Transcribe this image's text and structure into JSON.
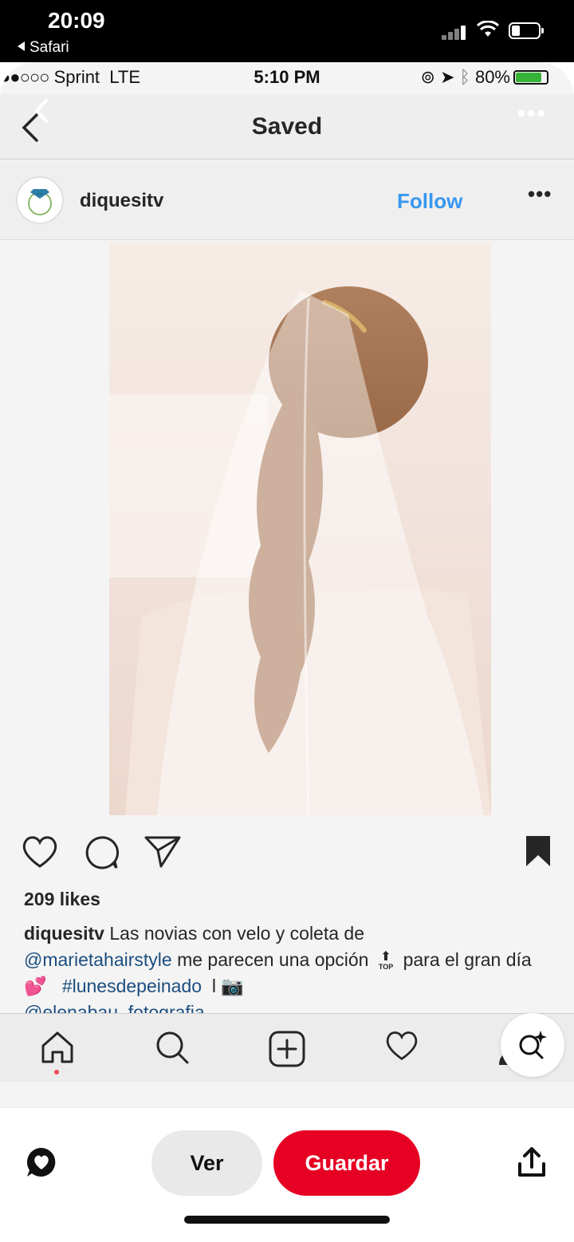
{
  "outer_status": {
    "time": "20:09",
    "back_label": "Safari"
  },
  "inner_status": {
    "carrier": "Sprint",
    "network": "LTE",
    "time": "5:10 PM",
    "battery": "80%",
    "battery_color": "#36b336"
  },
  "header": {
    "title": "Saved"
  },
  "post": {
    "username": "diquesitv",
    "follow_label": "Follow",
    "more_label": "•••",
    "likes": "209 likes",
    "caption": {
      "user": "diquesitv",
      "text1": "Las novias con velo y coleta de",
      "mention": "@marietahairstyle",
      "text2": "me parecen una opción",
      "top_badge": "TOP",
      "text3": "para el gran día",
      "hashtag": "#lunesdepeinado",
      "separator": "l",
      "credit": "@elenabau_fotografia"
    },
    "image_alt": "Bride with long wavy ponytail and veil, seen from behind"
  },
  "tabbar": {
    "icons": [
      "home-icon",
      "search-icon",
      "add-icon",
      "activity-heart-icon",
      "profile-icon"
    ],
    "active_color": "#ed4956"
  },
  "pinterest": {
    "ver_label": "Ver",
    "guardar_label": "Guardar",
    "brand_color": "#e60023"
  },
  "colors": {
    "follow": "#3897f0",
    "link": "#1c4e80"
  }
}
